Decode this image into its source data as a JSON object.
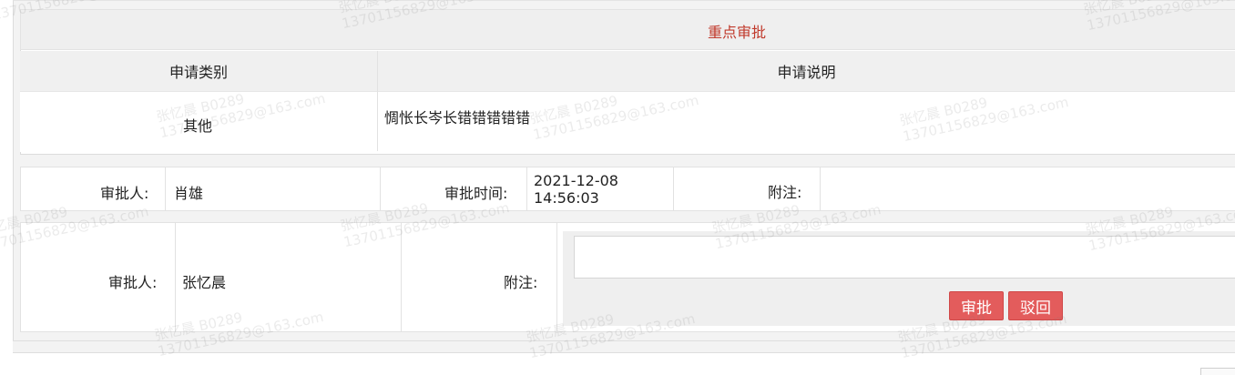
{
  "priority_approval": {
    "title": "重点审批"
  },
  "request_table": {
    "headers": {
      "category": "申请类别",
      "description": "申请说明"
    },
    "row": {
      "category": "其他",
      "description": "惆怅长岑长错错错错错"
    }
  },
  "previous_approval": {
    "approver_label": "审批人:",
    "approver_value": "肖雄",
    "time_label": "审批时间:",
    "time_date": "2021-12-08",
    "time_clock": "14:56:03",
    "note_label": "附注:",
    "note_value": ""
  },
  "current_approval": {
    "approver_label": "审批人:",
    "approver_value": "张忆晨",
    "note_label": "附注:",
    "note_input_value": "",
    "approve_button": "审批",
    "reject_button": "驳回"
  },
  "watermark": {
    "line1": "张忆晨 B0289",
    "line2": "13701156829@163.com"
  },
  "colors": {
    "title_red": "#c0392b",
    "button_red": "#e35c5c"
  }
}
